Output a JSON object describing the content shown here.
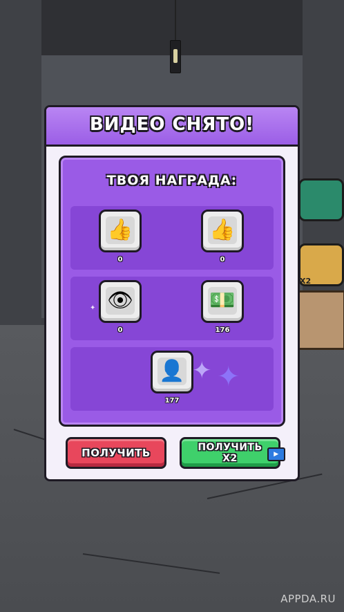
{
  "dialog": {
    "title": "ВИДЕО СНЯТО!",
    "reward_title": "ТВОЯ НАГРАДА:"
  },
  "rewards": [
    {
      "icon": "thumbs-up-icon",
      "glyph": "👍",
      "value": "0"
    },
    {
      "icon": "coin-like-icon",
      "glyph": "👍",
      "value": "0"
    },
    {
      "icon": "eye-icon",
      "glyph": "👁",
      "value": "0"
    },
    {
      "icon": "money-icon",
      "glyph": "💵",
      "value": "176"
    },
    {
      "icon": "subscriber-icon",
      "glyph": "👤",
      "value": "177"
    }
  ],
  "buttons": {
    "claim": "ПОЛУЧИТЬ",
    "claim_x2_line1": "ПОЛУЧИТЬ",
    "claim_x2_line2": "X2",
    "ad_icon": "▶"
  },
  "side": {
    "x2_label": "X2"
  },
  "watermark": "APPDA.RU",
  "colors": {
    "header_purple": "#9b5ee6",
    "panel_purple": "#9a5be6",
    "claim_red": "#e8475c",
    "claim_green": "#3fd06b"
  }
}
